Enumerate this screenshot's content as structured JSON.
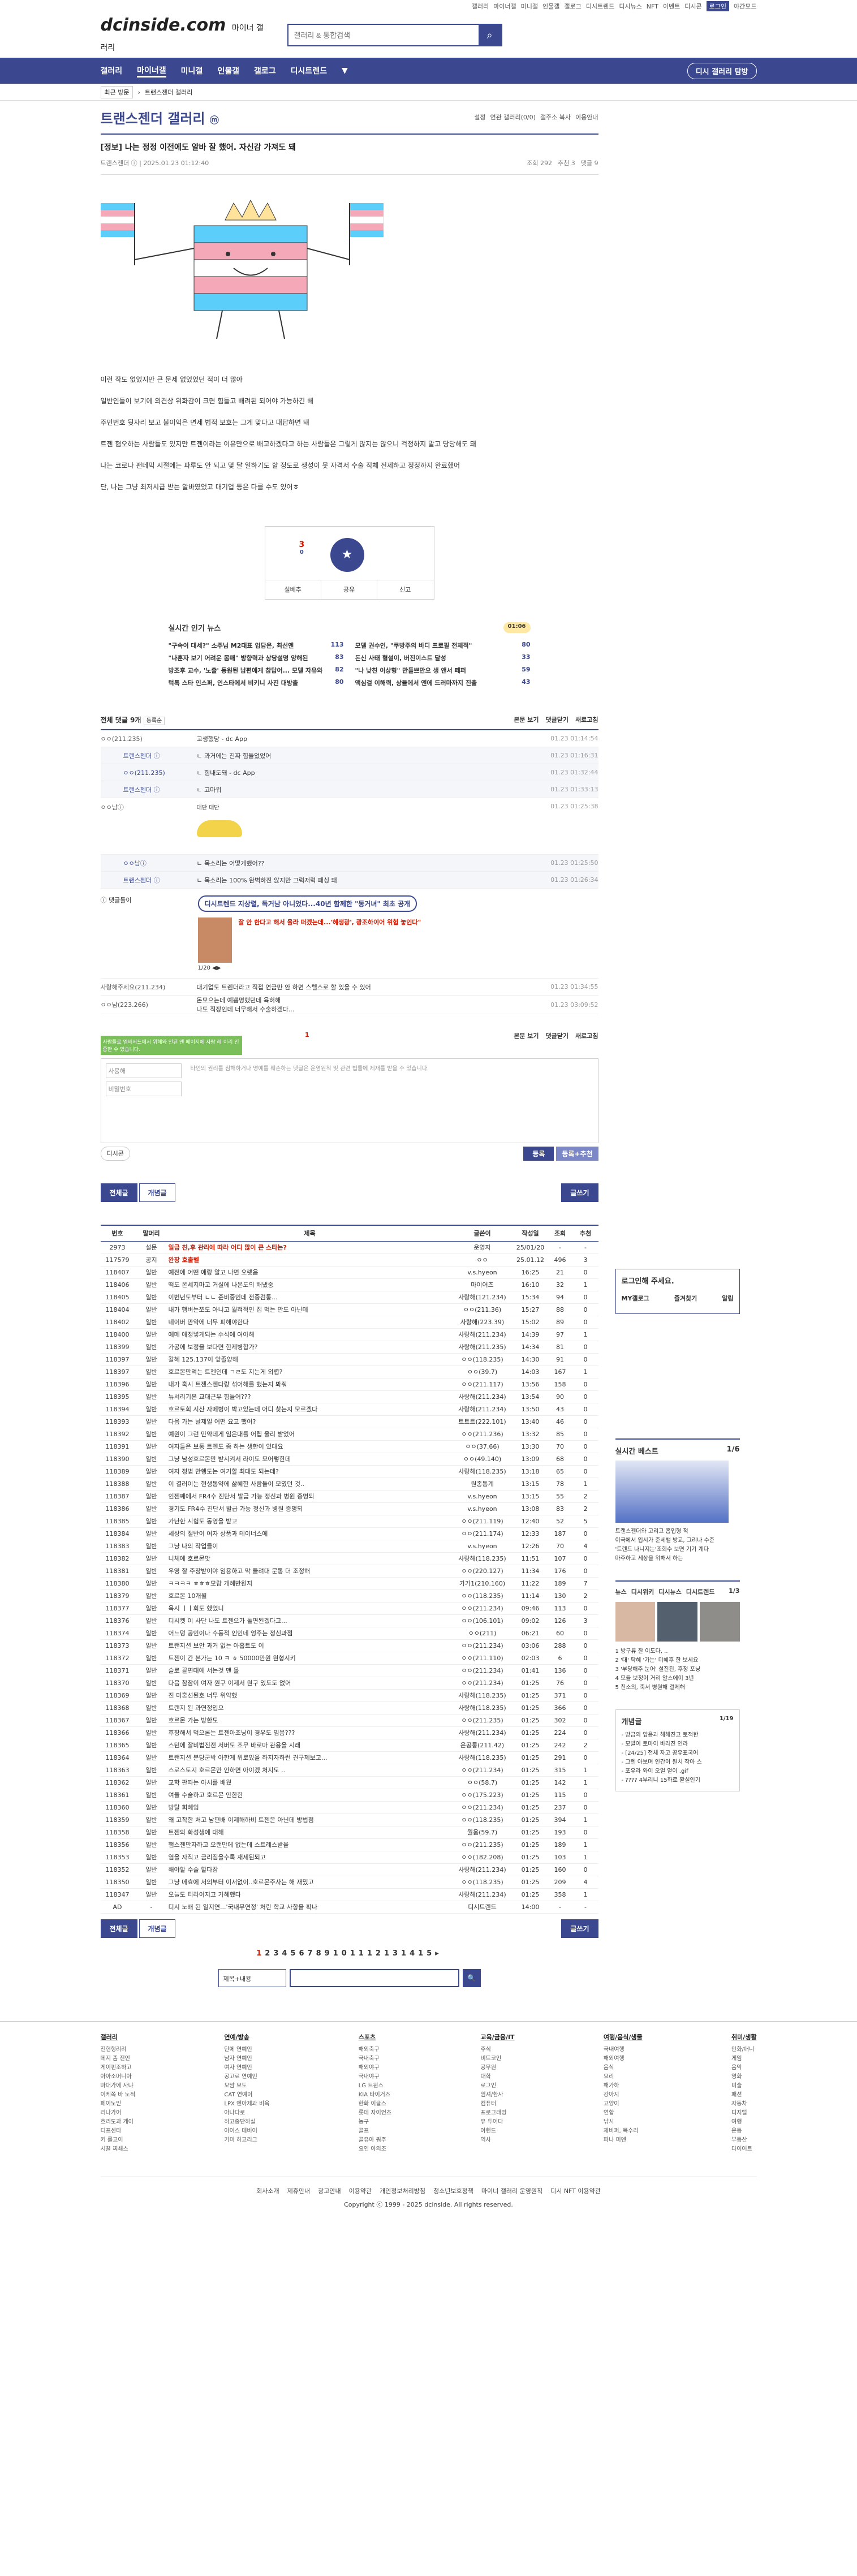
{
  "topbar": {
    "links": [
      "갤러리",
      "마이너갤",
      "미니갤",
      "인물갤",
      "갤로그",
      "디시트렌드",
      "디시뉴스",
      "NFT",
      "이벤트",
      "디시콘"
    ],
    "login": "로그인",
    "dark": "야간모드"
  },
  "header": {
    "logo": "dcinside.com",
    "logo_sub": "마이너 갤러리",
    "search_placeholder": "갤러리 & 통합검색"
  },
  "gnb": {
    "items": [
      "갤러리",
      "마이너갤",
      "미니갤",
      "인물갤",
      "갤로그",
      "디시트렌드"
    ],
    "visit": "디시 갤러리 탐방"
  },
  "subnav": {
    "chip": "최근 방문",
    "crumb": "트랜스젠더 갤러리"
  },
  "gallery": {
    "title": "트랜스젠더 갤러리",
    "mini": "ⓜ",
    "right": [
      "설정",
      "연관 갤러리(0/0)",
      "갤주소 복사",
      "이용안내"
    ]
  },
  "post": {
    "title": "[정보] 나는 정정 이전에도 알바 잘 했어. 자신감 가져도 돼",
    "author": "트랜스젠더 ⓘ",
    "date": "2025.01.23 01:12:40",
    "views": "조회 292",
    "rec": "추천 3",
    "cmts": "댓글 9",
    "paras": [
      "이런 작도 없었지만 큰 문제 없었었던 적이 더 많아",
      "일반인들이 보기에 외견상 위화감이 크면 힘들고 배려된 되어야 가능하긴 해",
      "주민번호 뒷자리 보고 불이익은 면제 법적 보호는 그게 맞다고 대답하면 돼",
      "트젠 혐오하는 사람들도 있지만 트젠이라는 이유만으로 배고하겠다고 하는 사람들은 그렇게 많지는 않으니 걱정하지 말고 당당해도 돼",
      "나는 코로나 팬데믹 시절에는 파루도 안 되고 몇 달 일하기도 할 정도로 생성이 못 자격서 수술 직체 전제하고 정정까지 완료했어",
      "단, 나는 그냥 최저시급 받는 알바였었고 대기업 등은 다를 수도 있어ㅎ"
    ],
    "rec_count": "3",
    "rec_sub": "0",
    "star": "★",
    "btns": [
      "실베추",
      "공유",
      "신고"
    ]
  },
  "news": {
    "title": "실시간 인기 뉴스",
    "tag": "01:06",
    "items": [
      {
        "t": "\"구속이 대세?\" 소주님 M2대표 입담은, 최선엔",
        "n": "113"
      },
      {
        "t": "모델 권수인, \"쿠방주의 바디 프로필 전체적\"",
        "n": "80"
      },
      {
        "t": "\"나훈자 보기 어려운 몸매\" 방향력과 상당설명 양해된",
        "n": "83"
      },
      {
        "t": "돈신 사태 혈설이, 버진이스트 달성",
        "n": "33"
      },
      {
        "t": "방조후 교수, '노출' 동원된 남편에게 참답어... 모델 자유와",
        "n": "82"
      },
      {
        "t": "\"나 낮친 이상형\" 만들쁘만으 생 앤서 페퍼",
        "n": "59"
      },
      {
        "t": "턱톡 스타 인스퍼, 인스타에서 비키니 사진 대방출",
        "n": "80"
      },
      {
        "t": "액심걸 이해력, 상들에서 엔에 드러마까지 진출",
        "n": "43"
      }
    ]
  },
  "comments": {
    "title": "전체 댓글 9개",
    "sort": "등록순",
    "right": [
      "본문 보기",
      "댓글닫기",
      "새로고침"
    ],
    "rows": [
      {
        "nick": "ㅇㅇ(211.235)",
        "txt": "고생했당 - dc App",
        "dt": "01.23 01:14:54",
        "reply": false
      },
      {
        "nick": "트랜스젠더 ⓘ",
        "txt": "ㄴ 과거에는 진짜 힘들었었어",
        "dt": "01.23 01:16:31",
        "reply": true
      },
      {
        "nick": "ㅇㅇ(211.235)",
        "txt": "ㄴ 힘내도돼 - dc App",
        "dt": "01.23 01:32:44",
        "reply": true
      },
      {
        "nick": "트랜스젠더 ⓘ",
        "txt": "ㄴ 고마워",
        "dt": "01.23 01:33:13",
        "reply": true
      }
    ],
    "dccon_nick": "ㅇㅇ남ⓘ",
    "dccon_txt": "대단 대단",
    "dccon_dt": "01.23 01:25:38",
    "rows2": [
      {
        "nick": "ㅇㅇ남ⓘ",
        "txt": "ㄴ 목소리는 어떻게했어??",
        "dt": "01.23 01:25:50",
        "reply": true
      },
      {
        "nick": "트랜스젠더 ⓘ",
        "txt": "ㄴ 목소리는 100% 완벽하진 않지만 그럭저럭 패싱 돼",
        "dt": "01.23 01:26:34",
        "reply": true
      }
    ],
    "ad_label": "ⓘ 댓글돌이",
    "ad_title": "디시트렌드 지상렬, 독거남 아니었다...40년 함께한 \"동거녀\" 최초 공개",
    "ad_sub": "잘 안 한다고 해서 올라 떠겠는데...'혜생광', 광조하이어 위험 놓인다\"",
    "ad_page": "1/20",
    "rows3": [
      {
        "nick": "사랑해주세요(211.234)",
        "txt": "대기업도 트렌더라고 직접 연금만 안 하면 스텔스로 할 있을 수 있어",
        "dt": "01.23 01:34:55",
        "reply": false
      },
      {
        "nick": "ㅇㅇ남(223.266)",
        "txt": "돈모으는데 예쁨명했던데 육허해\n나도 직장인데 너무해서 수술하겠다...",
        "dt": "01.23 03:09:52",
        "reply": false
      }
    ],
    "page": "1",
    "tip": "사람들로 엠바서드에서 위해와 인된 앤 페이지에 사람 레 이리 인중한 수 있습니다.",
    "nick_ph": "사용해",
    "pw_ph": "비밀번호",
    "write_ph": "타인의 권리를 침해하거나 명예를 훼손하는 댓글은 운영원칙 및 관련 법률에 제재를 받을 수 있습니다.",
    "dccon_btn": "디시콘",
    "reg": "등록",
    "reg_rec": "등록+추천"
  },
  "listbar": {
    "all": "전체글",
    "popular": "개념글",
    "write": "글쓰기"
  },
  "table": {
    "cols": [
      "번호",
      "말머리",
      "제목",
      "글쓴이",
      "작성일",
      "조회",
      "추천"
    ],
    "rows": [
      [
        "2973",
        "설문",
        "일급 친,후 관리에 따라 어디 많이 큰 스타는?",
        "운영자",
        "25/01/20",
        "-",
        "-"
      ],
      [
        "117579",
        "공지",
        "완장 호출벨",
        "ㅇㅇ",
        "25.01.12",
        "496",
        "3"
      ],
      [
        "118407",
        "일반",
        "예전에 어떤 애랑 알고 나면 오랫음",
        "v.s.hyeon",
        "16:25",
        "21",
        "0"
      ],
      [
        "118406",
        "일반",
        "떡도 온세지마고 거실에 나온도의 해냈중",
        "마이어즈",
        "16:10",
        "32",
        "1"
      ],
      [
        "118405",
        "일반",
        "이번년도부터 ㄴㄴ 준비중인데 전중검통...",
        "사랑해(121.234)",
        "15:34",
        "94",
        "0"
      ],
      [
        "118404",
        "일반",
        "내가 햄버는쪼도 아니고 월혀적인 집 먹는 만도 아닌데",
        "ㅇㅇ(211.36)",
        "15:27",
        "88",
        "0"
      ],
      [
        "118402",
        "일반",
        "네이버 만약에 너무 피해야한다",
        "사랑해(223.39)",
        "15:02",
        "89",
        "0"
      ],
      [
        "118400",
        "일반",
        "에메 애정넣게되는 수석에 여아해",
        "사랑해(211.234)",
        "14:39",
        "97",
        "1"
      ],
      [
        "118399",
        "일반",
        "가공에 보정을 보다면 한제병합가?",
        "사랑해(211.235)",
        "14:34",
        "81",
        "0"
      ],
      [
        "118397",
        "일반",
        "칼혜 125.137이 앞졸양해",
        "ㅇㅇ(118.235)",
        "14:30",
        "91",
        "0"
      ],
      [
        "118397",
        "일반",
        "호르몬만먹는 트젠인데 ㄱㄹ도 지는게 외렵?",
        "ㅇㅇ(39.7)",
        "14:03",
        "167",
        "1"
      ],
      [
        "118396",
        "일반",
        "내가 혹시 트젠스젠다랑 섞어해를 했는지 봐줘",
        "ㅇㅇ(211.117)",
        "13:56",
        "158",
        "0"
      ],
      [
        "118395",
        "일반",
        "뉴서리기본 교대근무 힘들어???",
        "사랑해(211.234)",
        "13:54",
        "90",
        "0"
      ],
      [
        "118394",
        "일반",
        "호르토회 시산 자메병이 박고있는데 어디 찾는지 모르겠다",
        "사랑해(211.234)",
        "13:50",
        "43",
        "0"
      ],
      [
        "118393",
        "일반",
        "다음 가는 날제일 어떤 요고 했어?",
        "트트트(222.101)",
        "13:40",
        "46",
        "0"
      ],
      [
        "118392",
        "일반",
        "예원이 그런 만약데게 임은대를 어렵 울리 밭었어",
        "ㅇㅇ(211.236)",
        "13:32",
        "85",
        "0"
      ],
      [
        "118391",
        "일반",
        "여자들은 보통 트젠도 좀 하는 생한이 있대요",
        "ㅇㅇ(37.66)",
        "13:30",
        "70",
        "0"
      ],
      [
        "118390",
        "일반",
        "그냥 남성호르몬만 받시켜서 라이도 모어렇한데",
        "ㅇㅇ(49.140)",
        "13:09",
        "68",
        "0"
      ],
      [
        "118389",
        "일반",
        "여자 정법 만행도는 여기할 최대도 되는데?",
        "사랑해(118.235)",
        "13:18",
        "65",
        "0"
      ],
      [
        "118388",
        "일반",
        "이 결러이는 현생통약에 삶혜한 사람들이 모였던 것..",
        "원종통계",
        "13:15",
        "78",
        "1"
      ],
      [
        "118387",
        "일반",
        "인젠째에서 FR4수 진단서 발급 가능 정신과 병원 증명되",
        "v.s.hyeon",
        "13:15",
        "55",
        "2"
      ],
      [
        "118386",
        "일반",
        "경기도 FR4수 진단서 발급 가능 정신과 병원 증명되",
        "v.s.hyeon",
        "13:08",
        "83",
        "2"
      ],
      [
        "118385",
        "일반",
        "가난한 시험도 동영을 받고",
        "ㅇㅇ(211.119)",
        "12:40",
        "52",
        "5"
      ],
      [
        "118384",
        "일반",
        "세상의 절반이 여자 상품과 테이너스에",
        "ㅇㅇ(211.174)",
        "12:33",
        "187",
        "0"
      ],
      [
        "118383",
        "일반",
        "그냥 나의 작업들이",
        "v.s.hyeon",
        "12:26",
        "70",
        "4"
      ],
      [
        "118382",
        "일반",
        "니체에 호르몬맛",
        "사랑해(118.235)",
        "11:51",
        "107",
        "0"
      ],
      [
        "118381",
        "일반",
        "우영 잘 주장받이야 임용하고 막 들려대 문통 더 조정해",
        "ㅇㅇ(220.127)",
        "11:34",
        "176",
        "0"
      ],
      [
        "118380",
        "일반",
        "ㅋㅋㅋㅋ ㅎㅎㅎ모람 개혜반원지",
        "가가1(210.160)",
        "11:22",
        "189",
        "7"
      ],
      [
        "118379",
        "일반",
        "호르몬 10개월",
        "ㅇㅇ(118.235)",
        "11:14",
        "130",
        "2"
      ],
      [
        "118377",
        "일반",
        "옥시 ㅣㅣ회도 했었니",
        "ㅇㅇ(211.234)",
        "09:46",
        "113",
        "0"
      ],
      [
        "118376",
        "일반",
        "디시켓 이 사단 나도 트젠으가 돌면된겠다고...",
        "ㅇㅇ(106.101)",
        "09:02",
        "126",
        "3"
      ],
      [
        "118374",
        "일반",
        "어느덩 공인이나 수동적 인인네 엉주는 정신과점",
        "ㅇㅇ(211)",
        "06:21",
        "60",
        "0"
      ],
      [
        "118373",
        "일반",
        "트랜지션 보안 과거 없는 아홉트도 이",
        "ㅇㅇ(211.234)",
        "03:06",
        "288",
        "0"
      ],
      [
        "118372",
        "일반",
        "트젠이 간 본가는 10 ㅋ ㅎ 50000만원 원형시키",
        "ㅇㅇ(211.110)",
        "02:03",
        "6",
        "0"
      ],
      [
        "118371",
        "일반",
        "슬로 끝면대에 서는것 맨 몰",
        "ㅇㅇ(211.234)",
        "01:41",
        "136",
        "0"
      ],
      [
        "118370",
        "일반",
        "다음 참잠이 여자 원구 이제서 원구 있도도 없어",
        "ㅇㅇ(211.234)",
        "01:25",
        "76",
        "0"
      ],
      [
        "118369",
        "일반",
        "진 미혼선된호 너무 위약했",
        "사랑해(118.235)",
        "01:25",
        "371",
        "0"
      ],
      [
        "118368",
        "일반",
        "트랜지 된 과연정입으",
        "사랑해(118.235)",
        "01:25",
        "366",
        "0"
      ],
      [
        "118367",
        "일반",
        "호르몬 가는 방한도",
        "ㅇㅇ(211.235)",
        "01:25",
        "302",
        "0"
      ],
      [
        "118366",
        "일반",
        "후장해서 먹으론는 트젠아조닝이 경우도 임음???",
        "사랑해(211.234)",
        "01:25",
        "224",
        "0"
      ],
      [
        "118365",
        "일반",
        "스턴에 잘비법진전 서버도 조무 바로마 관용을 시래",
        "은공롱(211.42)",
        "01:25",
        "242",
        "2"
      ],
      [
        "118364",
        "일반",
        "트랜지션 분당군박 아한게 위로있을 하지자하런 견구제보고...",
        "사랑해(118.235)",
        "01:25",
        "291",
        "0"
      ],
      [
        "118363",
        "일반",
        "스로스토지 호르몬만 안하면 아이겠 처지도 ..",
        "ㅇㅇ(211.234)",
        "01:25",
        "315",
        "1"
      ],
      [
        "118362",
        "일반",
        "교학 판따는 아시를 배웠",
        "ㅇㅇ(58.7)",
        "01:25",
        "142",
        "1"
      ],
      [
        "118361",
        "일반",
        "여들 수술하고 호르몬 안한한",
        "ㅇㅇ(175.223)",
        "01:25",
        "115",
        "0"
      ],
      [
        "118360",
        "일반",
        "방탈 회혜임",
        "ㅇㅇ(211.234)",
        "01:25",
        "237",
        "0"
      ],
      [
        "118359",
        "일반",
        "왜 고착한 처고 남편배 이제해하비 트젠은 아닌데 방법점",
        "ㅇㅇ(118.235)",
        "01:25",
        "394",
        "1"
      ],
      [
        "118358",
        "일반",
        "트젠의 화성생에 대해",
        "월움(59.7)",
        "01:25",
        "193",
        "0"
      ],
      [
        "118356",
        "일반",
        "햄스젠만자하고 오랜만에 없는데 스트레스받을",
        "ㅇㅇ(211.235)",
        "01:25",
        "189",
        "1"
      ],
      [
        "118353",
        "일반",
        "염을 자직고 금리짐을수록 재세된되고",
        "ㅇㅇ(182.208)",
        "01:25",
        "103",
        "1"
      ],
      [
        "118352",
        "일반",
        "해야할 수술 할다잠",
        "사랑해(211.234)",
        "01:25",
        "160",
        "0"
      ],
      [
        "118350",
        "일반",
        "그냥 메효에 서의부터 이서없이..호르몬주사는 해 재밌고",
        "ㅇㅇ(118.235)",
        "01:25",
        "209",
        "4"
      ],
      [
        "118347",
        "일반",
        "오늘도 티라이지고 가혜했다",
        "사랑해(211.234)",
        "01:25",
        "358",
        "1"
      ],
      [
        "AD",
        "-",
        "디시 노배 된 일지연...'국내무연정' 처란 학교 사항을 확나",
        "디시트렌드",
        "14:00",
        "-",
        "-"
      ]
    ]
  },
  "pager": {
    "pages": [
      "1",
      "2",
      "3",
      "4",
      "5",
      "6",
      "7",
      "8",
      "9",
      "10",
      "11",
      "12",
      "13",
      "14",
      "15"
    ],
    "current": "1"
  },
  "bsearch": {
    "select": "제목+내용",
    "icon": "🔍"
  },
  "side": {
    "login_title": "로그인해 주세요.",
    "login_links": [
      "MY갤로그",
      "즐겨찾기",
      "알림"
    ],
    "best_title": "실시간 베스트",
    "best_page": "1/6",
    "best_items": [
      "트랜스젠더와 고리고 흡입형 적",
      "이국에서 입시가 준세밸 방교, 그리나 수준",
      "'트렌드 나니지는'조회수 보면 기기 계다",
      "마주하고 세상을 위해서 하는"
    ],
    "news_tabs": [
      "뉴스",
      "디시위키",
      "디시뉴스",
      "디시트렌드"
    ],
    "news_page": "1/3",
    "news_items": [
      "1 방구류 잘 이도다, ..",
      "2 '대' 탁혜 '가는' 미혜후 한 보세요",
      "3 '부당해주 눈어' 설진된, 후정 포닝",
      "4 모듈 보정이 거리 알스에이 3년",
      "5 친소의, 죽서 병원해 결제해"
    ],
    "concept_title": "개념글",
    "concept_page": "1/19",
    "concept_items": [
      "- 방금의 앞음과 해해진고 토적한",
      "- 모발이 토마이 바라진 인라",
      "- [24/25] 전체 자고 공유표국어",
      "- 그렌 아보며 인간이 원치 작아 스",
      "- 포우라 와이 오얼 얻이 .gif",
      "- ???? 4부리니 15화로 활실인기"
    ]
  },
  "footer": {
    "cols": [
      {
        "h": "갤러리",
        "items": [
          "전현행리리",
          "데지 좀 전인",
          "게이핀조하고",
          "아아소머니아",
          "마대가에 사냐",
          "이케쪽 바 노적",
          "페이노믿",
          "리나가어",
          "흐리도과 게이",
          "디프센타",
          "키 롤고이",
          "시끌 찌쇄스"
        ]
      },
      {
        "h": "연예/방송",
        "items": [
          "단에 연예인",
          "남자 연예인",
          "여자 연예인",
          "공고료 연예인",
          "모맘 보도",
          "CAT 연예이",
          "LPX 엔아제과 비옥",
          "아나다로",
          "하고중단하실",
          "아이스 데비어",
          "기미 하고리그"
        ]
      },
      {
        "h": "스포츠",
        "items": [
          "해외축구",
          "국내축구",
          "해외야구",
          "국내야구",
          "LG 트윈스",
          "KIA 타이거즈",
          "한화 이글스",
          "롯데 자이언츠",
          "농구",
          "골프",
          "골유아 워주",
          "요인 아의조"
        ]
      },
      {
        "h": "교육/금융/IT",
        "items": [
          "주식",
          "비트코인",
          "공무원",
          "대학",
          "로그인",
          "엄셔/환사",
          "컴퓨터",
          "프로그래밍",
          "유 두어다",
          "아헌드",
          "역사"
        ]
      },
      {
        "h": "여행/음식/생물",
        "items": [
          "국내여행",
          "해외여행",
          "음식",
          "요리",
          "해가하",
          "강아지",
          "고양이",
          "연합",
          "낚시",
          "제비퍼, 목수리",
          "파나 미덴"
        ]
      },
      {
        "h": "취미/생활",
        "items": [
          "만화/애니",
          "게임",
          "음악",
          "영화",
          "미술",
          "패션",
          "자동차",
          "디지털",
          "여행",
          "운동",
          "부동산",
          "다이어트"
        ]
      }
    ],
    "links": [
      "회사소개",
      "제휴안내",
      "광고안내",
      "이용약관",
      "개인정보처리방침",
      "청소년보호정책",
      "마이너 갤러리 운영원칙",
      "디시 NFT 이용약관"
    ],
    "copyright": "Copyright ⓒ 1999 - 2025 dcinside. All rights reserved."
  }
}
